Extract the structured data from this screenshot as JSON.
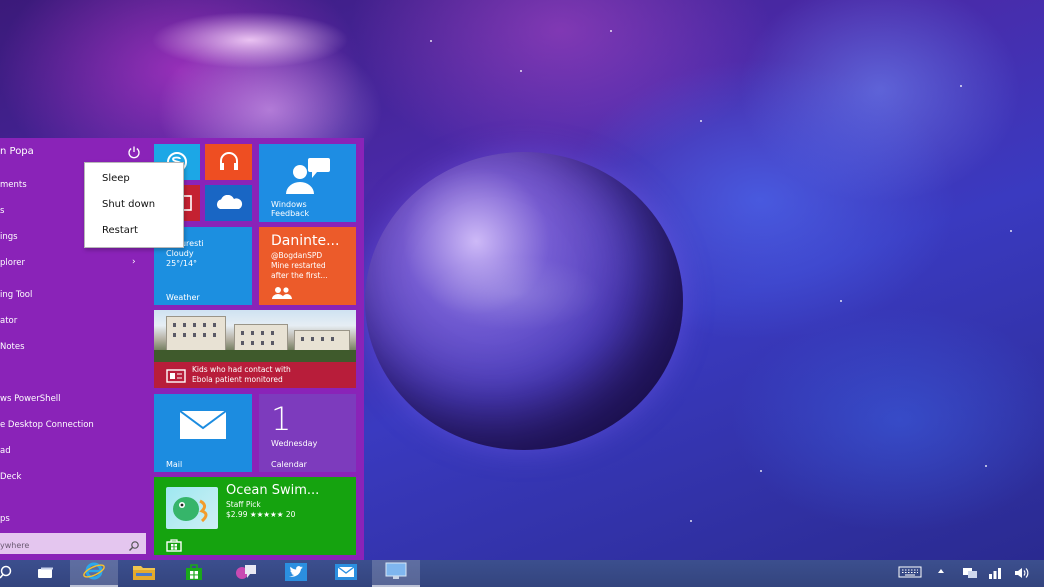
{
  "start_menu": {
    "user_name": "n Popa",
    "apps": [
      {
        "label": "ments"
      },
      {
        "label": "s"
      },
      {
        "label": "ings"
      },
      {
        "label": "plorer",
        "has_arrow": true
      },
      {
        "label": "ing Tool"
      },
      {
        "label": "ator"
      },
      {
        "label": "Notes"
      },
      {
        "label": "ws PowerShell"
      },
      {
        "label": "e Desktop Connection"
      },
      {
        "label": "ad"
      },
      {
        "label": "Deck"
      },
      {
        "label": "ps"
      }
    ],
    "search_placeholder": "ywhere",
    "arrow_glyph": "›"
  },
  "power_menu": {
    "options": [
      "Sleep",
      "Shut down",
      "Restart"
    ]
  },
  "tiles": {
    "feedback": {
      "label_line1": "Windows",
      "label_line2": "Feedback"
    },
    "weather": {
      "line1": "e",
      "city": "Bucuresti",
      "condition": "Cloudy",
      "temps": "25°/14°",
      "label": "Weather"
    },
    "people": {
      "title": "Daninte...",
      "handle": "@BogdanSPD",
      "line1": "Mine restarted",
      "line2": "after the first..."
    },
    "news": {
      "line1": "Kids who had contact with",
      "line2": "Ebola patient monitored"
    },
    "mail": {
      "label": "Mail"
    },
    "calendar": {
      "day": "1",
      "weekday": "Wednesday",
      "label": "Calendar"
    },
    "store": {
      "title": "Ocean Swim...",
      "subtitle": "Staff Pick",
      "price_rating": "$2.99 ★★★★★ 20"
    }
  },
  "taskbar": {
    "items": [
      "search",
      "task-view",
      "internet-explorer",
      "file-explorer",
      "store",
      "app-switch",
      "twitter",
      "mail",
      "remote-desktop"
    ],
    "active": "internet-explorer"
  },
  "colors": {
    "start_bg": "#8a23b8",
    "taskbar_bg": "#3c4f8e"
  }
}
